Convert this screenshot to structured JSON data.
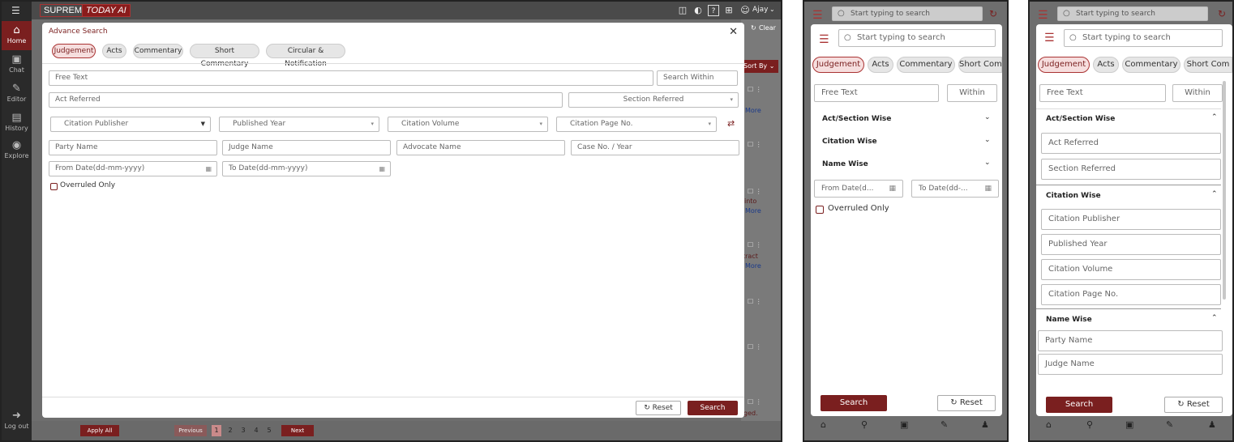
{
  "desktop": {
    "logo_left": "SUPREME",
    "logo_right": "TODAY AI",
    "user_name": "Ajay",
    "clear_label": "Clear",
    "sort_label": "Sort By",
    "sidenav": [
      {
        "label": "Home",
        "icon": "home-icon"
      },
      {
        "label": "Chat",
        "icon": "chat-icon"
      },
      {
        "label": "Editor",
        "icon": "editor-icon"
      },
      {
        "label": "History",
        "icon": "history-icon"
      },
      {
        "label": "Explore",
        "icon": "explore-icon"
      }
    ],
    "logout_label": "Log out",
    "apply_all": "Apply All",
    "pagination": {
      "prev": "Previous",
      "pages": [
        "1",
        "2",
        "3",
        "4",
        "5"
      ],
      "next": "Next",
      "current": "1"
    },
    "bg_more": "More",
    "bg_into": "into",
    "bg_tract": "tract",
    "bg_ged": "ged."
  },
  "modal": {
    "title": "Advance Search",
    "tabs": [
      "Judgement",
      "Acts",
      "Commentary",
      "Short Commentary",
      "Circular & Notification"
    ],
    "active_tab": "Judgement",
    "free_text": "Free Text",
    "search_within": "Search Within",
    "act_referred": "Act Referred",
    "section_referred": "Section Referred",
    "citation_publisher": "Citation Publisher",
    "published_year": "Published Year",
    "citation_volume": "Citation Volume",
    "citation_page": "Citation Page No.",
    "party_name": "Party Name",
    "judge_name": "Judge Name",
    "advocate_name": "Advocate Name",
    "case_no": "Case No. / Year",
    "from_date": "From Date(dd-mm-yyyy)",
    "to_date": "To Date(dd-mm-yyyy)",
    "overruled": "Overruled Only",
    "reset": "Reset",
    "search": "Search"
  },
  "phone1": {
    "search_placeholder": "Start typing to search",
    "tabs": [
      "Judgement",
      "Acts",
      "Commentary",
      "Short Com"
    ],
    "free_text": "Free Text",
    "within": "Within",
    "sections": [
      "Act/Section Wise",
      "Citation Wise",
      "Name Wise"
    ],
    "from_date": "From Date(d...",
    "to_date": "To Date(dd-...",
    "overruled": "Overruled Only",
    "search": "Search",
    "reset": "Reset"
  },
  "phone2": {
    "search_placeholder": "Start typing to search",
    "tabs": [
      "Judgement",
      "Acts",
      "Commentary",
      "Short Com"
    ],
    "free_text": "Free Text",
    "within": "Within",
    "act_section_label": "Act/Section Wise",
    "act_referred": "Act Referred",
    "section_referred": "Section Referred",
    "citation_label": "Citation Wise",
    "citation_publisher": "Citation Publisher",
    "published_year": "Published Year",
    "citation_volume": "Citation Volume",
    "citation_page": "Citation Page No.",
    "name_label": "Name Wise",
    "party_name": "Party Name",
    "judge_name": "Judge Name",
    "search": "Search",
    "reset": "Reset"
  },
  "colors": {
    "brand": "#7a1f1f",
    "accent_pill": "#f6dede"
  }
}
